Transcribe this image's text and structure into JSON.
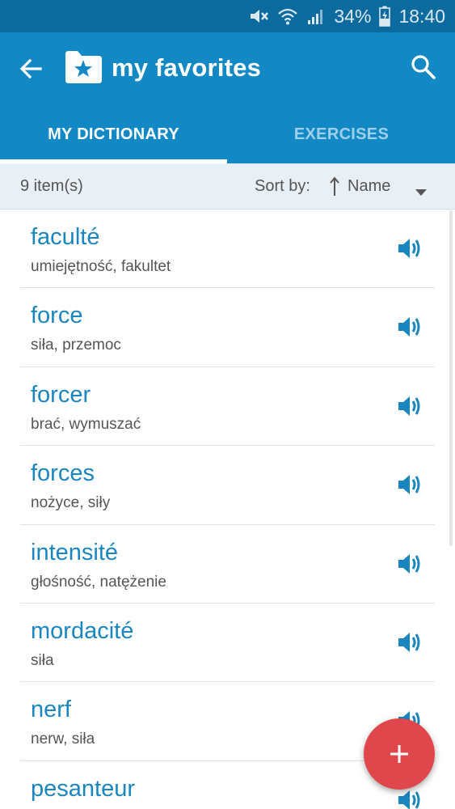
{
  "status_bar": {
    "battery_text": "34%",
    "time": "18:40",
    "icons": [
      "mute-icon",
      "wifi-icon",
      "signal-icon",
      "battery-charging-icon"
    ]
  },
  "app_bar": {
    "title": "my favorites",
    "icons": [
      "back-arrow-icon",
      "folder-star-icon",
      "search-icon"
    ],
    "color": "#1289c4"
  },
  "tabs": [
    {
      "label": "MY DICTIONARY",
      "active": true
    },
    {
      "label": "EXERCISES",
      "active": false
    }
  ],
  "sort_bar": {
    "item_count": "9 item(s)",
    "sort_label": "Sort by:",
    "sort_value": "Name",
    "icons": [
      "sort-ascending-icon",
      "dropdown-triangle-icon"
    ]
  },
  "entries": [
    {
      "word": "faculté",
      "translation": "umiejętność, fakultet"
    },
    {
      "word": "force",
      "translation": "siła, przemoc"
    },
    {
      "word": "forcer",
      "translation": "brać, wymuszać"
    },
    {
      "word": "forces",
      "translation": "nożyce, siły"
    },
    {
      "word": "intensité",
      "translation": "głośność, natężenie"
    },
    {
      "word": "mordacité",
      "translation": "siła"
    },
    {
      "word": "nerf",
      "translation": "nerw, siła"
    },
    {
      "word": "pesanteur",
      "translation": ""
    }
  ],
  "fab": {
    "icon": "plus-icon",
    "color": "#e0474c"
  },
  "colors": {
    "status_bar": "#0b6a9e",
    "accent": "#1289c4",
    "word_text": "#1a86bf",
    "sort_bar_bg": "#e8eff5"
  }
}
